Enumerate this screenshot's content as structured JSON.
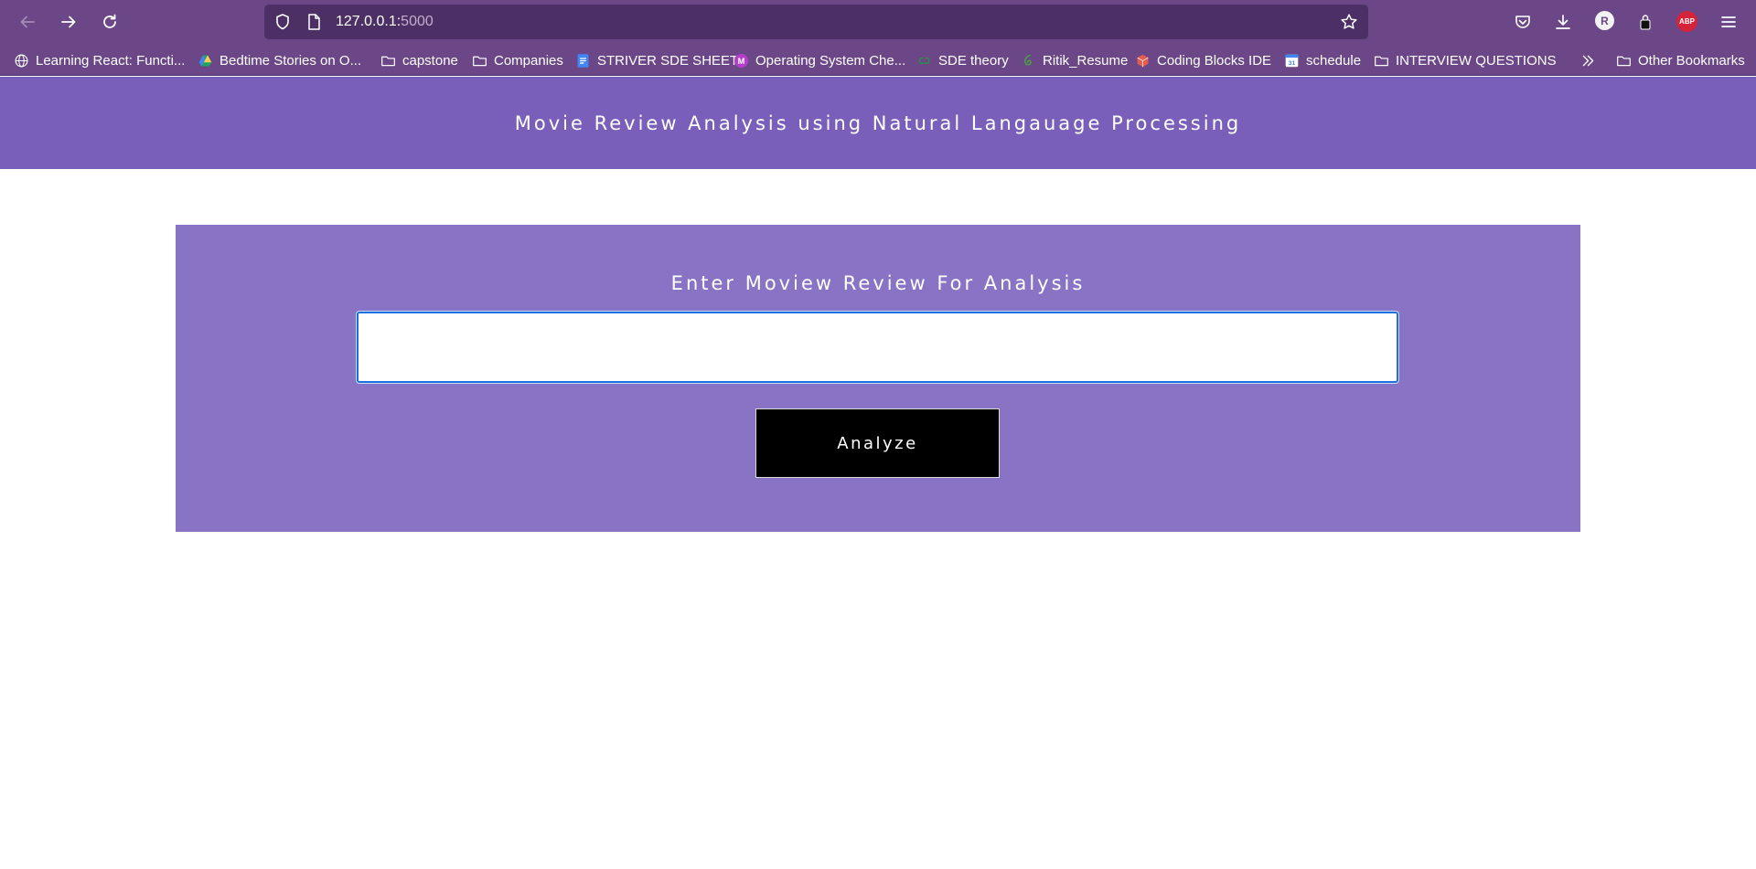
{
  "browser": {
    "url_host": "127.0.0.1:",
    "url_port": "5000",
    "profile_initial": "R",
    "adblock_label": "ABP",
    "bookmarks": [
      {
        "label": "Learning React: Functi...",
        "icon": "globe-icon"
      },
      {
        "label": "Bedtime Stories on O...",
        "icon": "google-drive-icon"
      },
      {
        "label": "capstone",
        "icon": "folder-icon"
      },
      {
        "label": "Companies",
        "icon": "folder-icon"
      },
      {
        "label": "STRIVER SDE SHEET",
        "icon": "google-docs-icon"
      },
      {
        "label": "Operating System Che...",
        "icon": "m-badge-icon"
      },
      {
        "label": "SDE theory",
        "icon": "gfg-icon"
      },
      {
        "label": "Ritik_Resume",
        "icon": "overleaf-icon"
      },
      {
        "label": "Coding Blocks IDE",
        "icon": "cube-icon"
      },
      {
        "label": "schedule",
        "icon": "calendar-icon"
      },
      {
        "label": "INTERVIEW QUESTIONS",
        "icon": "folder-icon"
      }
    ],
    "other_bookmarks": "Other Bookmarks",
    "calendar_day": "31",
    "m_badge_letter": "M"
  },
  "page": {
    "title": "Movie Review Analysis using Natural Langauage Processing",
    "form_heading": "Enter Moview Review For Analysis",
    "input_value": "",
    "input_placeholder": "",
    "button_label": "Analyze"
  },
  "colors": {
    "toolbar": "#6b4787",
    "urlbar": "#4c2f64",
    "header": "#7a5fba",
    "card": "#8973c4",
    "button": "#000000"
  }
}
